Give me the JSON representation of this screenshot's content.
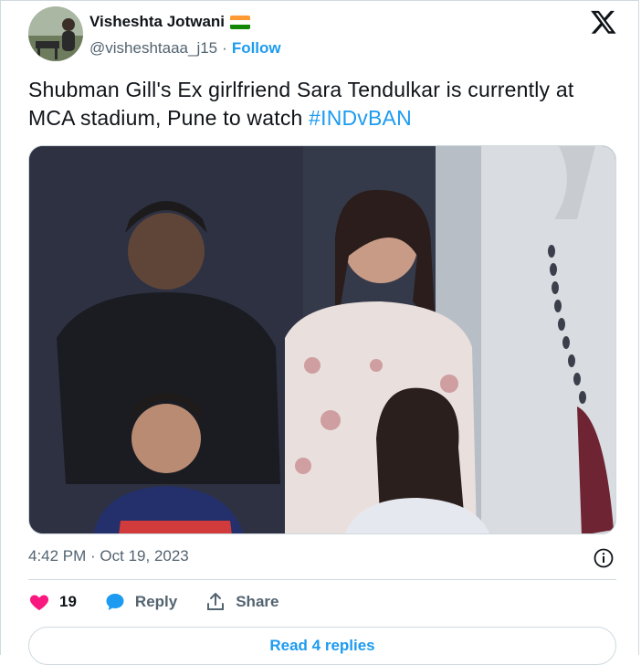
{
  "author": {
    "display_name": "Visheshta Jotwani",
    "handle": "@visheshtaaa_j15",
    "separator": "·",
    "follow_label": "Follow",
    "flag_icon": "india-flag-icon"
  },
  "tweet": {
    "text": "Shubman Gill's Ex girlfriend Sara Tendulkar is currently at MCA stadium, Pune to watch ",
    "hashtag": "#INDvBAN",
    "timestamp": "4:42 PM · Oct 19, 2023"
  },
  "actions": {
    "like_count": "19",
    "reply_label": "Reply",
    "share_label": "Share"
  },
  "footer": {
    "read_replies_label": "Read 4 replies"
  },
  "colors": {
    "accent": "#1d9bf0",
    "like": "#f91880",
    "muted": "#536471"
  }
}
